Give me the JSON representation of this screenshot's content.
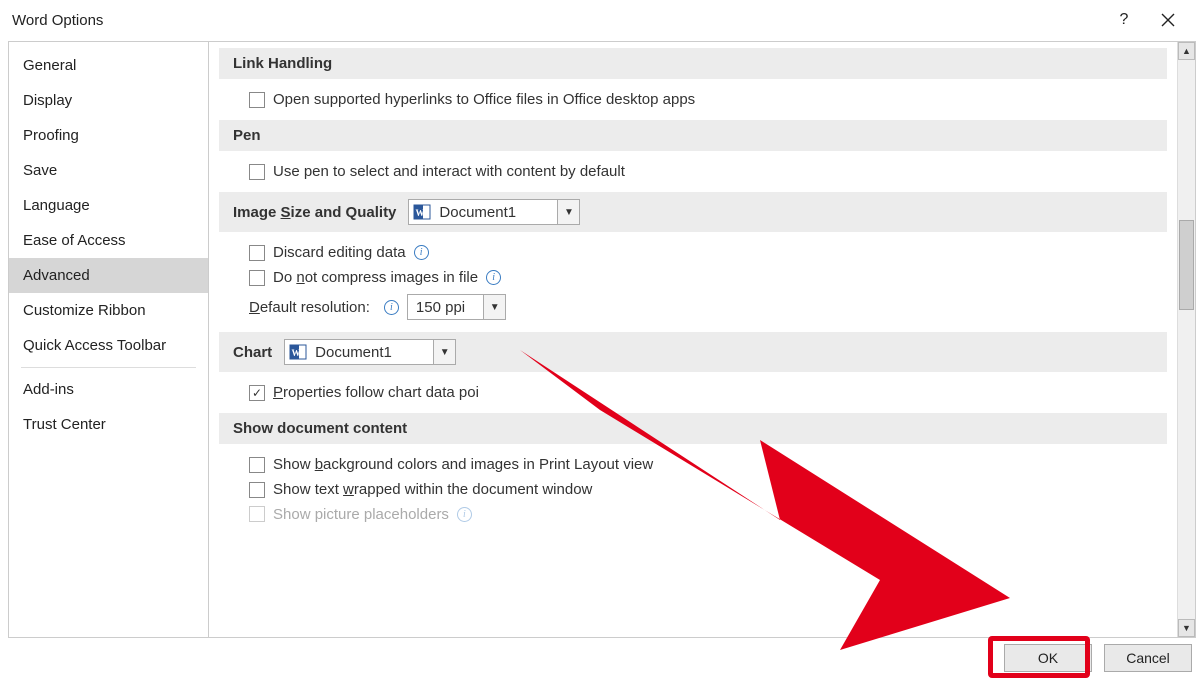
{
  "window": {
    "title": "Word Options"
  },
  "sidebar": {
    "items": [
      "General",
      "Display",
      "Proofing",
      "Save",
      "Language",
      "Ease of Access",
      "Advanced",
      "Customize Ribbon",
      "Quick Access Toolbar",
      "Add-ins",
      "Trust Center"
    ],
    "selected_index": 6
  },
  "sections": {
    "link_handling": {
      "title": "Link Handling",
      "open_hyperlinks": "Open supported hyperlinks to Office files in Office desktop apps"
    },
    "pen": {
      "title": "Pen",
      "use_pen": "Use pen to select and interact with content by default"
    },
    "image": {
      "title_pre": "Image ",
      "title_u": "S",
      "title_post": "ize and Quality",
      "doc_select": "Document1",
      "discard": "Discard editing data",
      "no_compress_pre": "Do ",
      "no_compress_u": "n",
      "no_compress_post": "ot compress images in file",
      "resolution_label_u": "D",
      "resolution_label_post": "efault resolution:",
      "resolution_value": "150 ppi"
    },
    "chart": {
      "title": "Chart",
      "doc_select": "Document1",
      "props_u": "P",
      "props_post": "roperties follow chart data poi"
    },
    "showdoc": {
      "title": "Show document content",
      "bg_pre": "Show ",
      "bg_u": "b",
      "bg_post": "ackground colors and images in Print Layout view",
      "wrap_pre": "Show text ",
      "wrap_u": "w",
      "wrap_post": "rapped within the document window",
      "placeholders": "Show picture placeholders"
    }
  },
  "buttons": {
    "ok": "OK",
    "cancel": "Cancel"
  }
}
